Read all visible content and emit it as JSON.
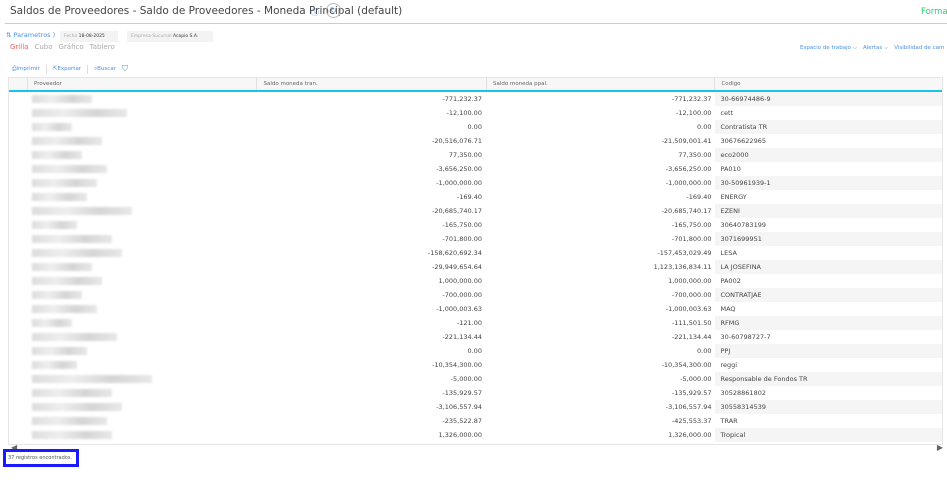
{
  "header": {
    "title": "Saldos de Proveedores - Saldo de Proveedores - Moneda Principal (default)",
    "format_label": "Forma"
  },
  "filters": {
    "params_label": "Parametros )",
    "fecha_label": "Fecha",
    "fecha_value": "18-08-2025",
    "empresa_label": "Empresa-Sucursal",
    "empresa_value": "Acopio S.A."
  },
  "views": [
    "Grilla",
    "Cubo",
    "Gráfico",
    "Tablero"
  ],
  "right_menu": [
    "Espacio de trabajo ⌵",
    "Alertas ⌵",
    "Visibilidad de cam"
  ],
  "toolbar": {
    "print": "Imprimir",
    "export": "Exportar",
    "search": "Buscar"
  },
  "columns": [
    "Proveedor",
    "Saldo moneda tran.",
    "Saldo moneda ppal.",
    "Codigo"
  ],
  "rows": [
    {
      "tran": "-771,232.37",
      "ppal": "-771,232.37",
      "codigo": "30-66974486-9"
    },
    {
      "tran": "-12,100.00",
      "ppal": "-12,100.00",
      "codigo": "cett"
    },
    {
      "tran": "0.00",
      "ppal": "0.00",
      "codigo": "Contratista TR"
    },
    {
      "tran": "-20,516,076.71",
      "ppal": "-21,509,001.41",
      "codigo": "30676622965"
    },
    {
      "tran": "77,350.00",
      "ppal": "77,350.00",
      "codigo": "eco2000"
    },
    {
      "tran": "-3,656,250.00",
      "ppal": "-3,656,250.00",
      "codigo": "PA010"
    },
    {
      "tran": "-1,000,000.00",
      "ppal": "-1,000,000.00",
      "codigo": "30-50961939-1"
    },
    {
      "tran": "-169.40",
      "ppal": "-169.40",
      "codigo": "ENERGY"
    },
    {
      "tran": "-20,685,740.17",
      "ppal": "-20,685,740.17",
      "codigo": "EZENI"
    },
    {
      "tran": "-165,750.00",
      "ppal": "-165,750.00",
      "codigo": "30640783199"
    },
    {
      "tran": "-701,800.00",
      "ppal": "-701,800.00",
      "codigo": "3071699951"
    },
    {
      "tran": "-158,620,692.34",
      "ppal": "-157,453,029.49",
      "codigo": "LESA"
    },
    {
      "tran": "-29,949,654.64",
      "ppal": "1,123,136,834.11",
      "codigo": "LA JOSEFINA"
    },
    {
      "tran": "1,000,000.00",
      "ppal": "1,000,000.00",
      "codigo": "PA002"
    },
    {
      "tran": "-700,000.00",
      "ppal": "-700,000.00",
      "codigo": "CONTRATJAE"
    },
    {
      "tran": "-1,000,003.63",
      "ppal": "-1,000,003.63",
      "codigo": "MAQ"
    },
    {
      "tran": "-121.00",
      "ppal": "-111,501.50",
      "codigo": "RFMG"
    },
    {
      "tran": "-221,134.44",
      "ppal": "-221,134.44",
      "codigo": "30-60798727-7"
    },
    {
      "tran": "0.00",
      "ppal": "0.00",
      "codigo": "PPJ"
    },
    {
      "tran": "-10,354,300.00",
      "ppal": "-10,354,300.00",
      "codigo": "reggi"
    },
    {
      "tran": "-5,000.00",
      "ppal": "-5,000.00",
      "codigo": "Responsable de Fondos TR"
    },
    {
      "tran": "-135,929.57",
      "ppal": "-135,929.57",
      "codigo": "30528861802"
    },
    {
      "tran": "-3,106,557.94",
      "ppal": "-3,106,557.94",
      "codigo": "30558314539"
    },
    {
      "tran": "-235,522.87",
      "ppal": "-425,553.37",
      "codigo": "TRAR"
    },
    {
      "tran": "1,326,000.00",
      "ppal": "1,326,000.00",
      "codigo": "Tropical"
    }
  ],
  "footer": {
    "count_text": "37 registros encontrados."
  }
}
